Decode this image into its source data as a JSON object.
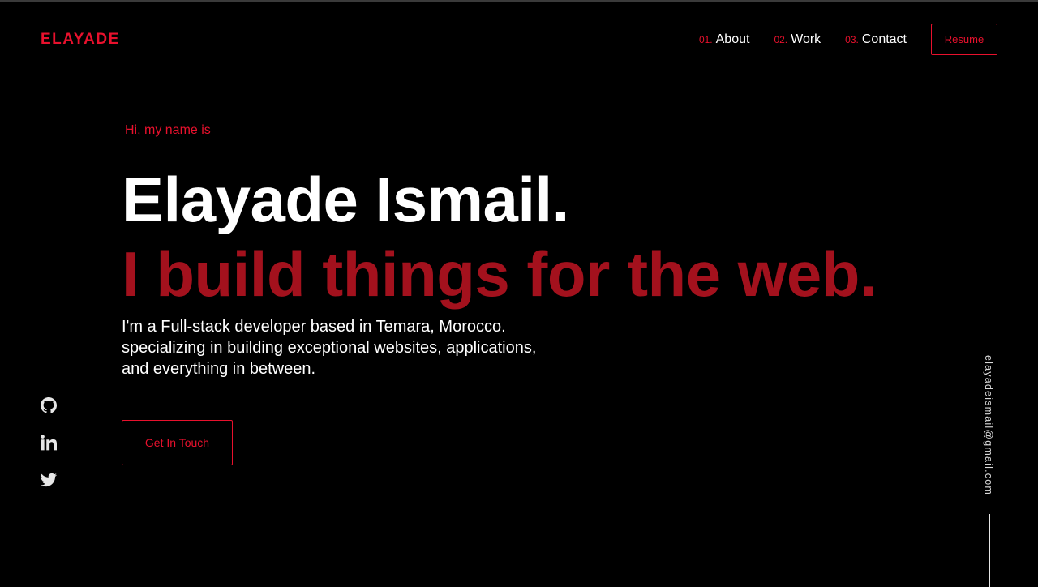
{
  "logo": {
    "text": "ELAYADE"
  },
  "nav": {
    "items": [
      {
        "num": "01.",
        "label": "About"
      },
      {
        "num": "02.",
        "label": "Work"
      },
      {
        "num": "03.",
        "label": "Contact"
      }
    ],
    "resume_label": "Resume"
  },
  "hero": {
    "greeting": "Hi, my name is",
    "name": "Elayade Ismail.",
    "tagline": "I build things for the web.",
    "description": "I'm a Full-stack developer based in Temara, Morocco. specializing in building exceptional websites, applications, and everything in between.",
    "cta_label": "Get In Touch"
  },
  "social": {
    "icons": [
      "github-icon",
      "linkedin-icon",
      "twitter-icon"
    ]
  },
  "email": "elayadeismail@gmail.com",
  "colors": {
    "background": "#000000",
    "accent": "#e8112d",
    "tagline": "#a3111d",
    "text": "#ffffff"
  }
}
